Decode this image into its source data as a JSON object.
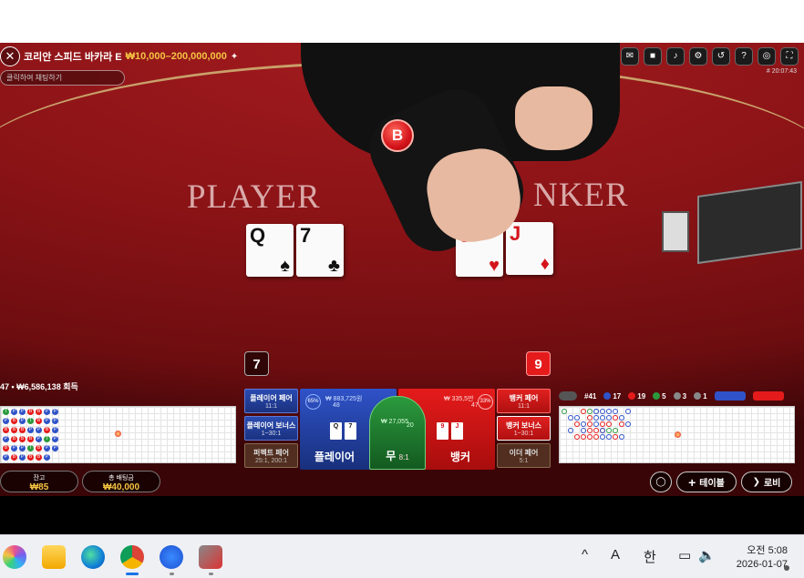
{
  "header": {
    "close_icon": "close-icon",
    "title": "코리안 스피드 바카라 E",
    "limits": "₩10,000–200,000,000",
    "chat_placeholder": "클릭하여 채팅하기",
    "game_id": "# 20:07:43"
  },
  "toolbar_icons": [
    "chat-icon",
    "video-icon",
    "sound-icon",
    "settings-icon",
    "history-icon",
    "help-icon",
    "lobby-icon",
    "fullscreen-icon"
  ],
  "table": {
    "player_word": "PLAYER",
    "banker_word": "NKER",
    "chip_label": "B",
    "player_cards": [
      {
        "rank": "Q",
        "suit": "♠",
        "color": "blk"
      },
      {
        "rank": "7",
        "suit": "♣",
        "color": "blk"
      }
    ],
    "banker_cards": [
      {
        "rank": "9",
        "suit": "♥",
        "color": "red"
      },
      {
        "rank": "J",
        "suit": "♦",
        "color": "red"
      }
    ]
  },
  "scores": {
    "player": "7",
    "banker": "9"
  },
  "total_line": "47 • ₩6,586,138 회득",
  "balance": {
    "label": "잔고",
    "value": "₩85"
  },
  "total_bet": {
    "label": "총 배팅금",
    "value": "₩40,000"
  },
  "side_bets": {
    "player_pair": {
      "label": "플레이어 페어",
      "odds": "11:1"
    },
    "player_bonus": {
      "label": "플레이어 보너스",
      "odds": "1~30:1"
    },
    "perfect_pair": {
      "label": "퍼펙트 페어",
      "odds": "25:1, 200:1"
    },
    "banker_pair": {
      "label": "뱅커 페어",
      "odds": "11:1"
    },
    "banker_bonus": {
      "label": "뱅커 보너스",
      "odds": "1~30:1"
    },
    "either_pair": {
      "label": "이더 페어",
      "odds": "5:1"
    }
  },
  "main_bets": {
    "player": {
      "label": "플레이어",
      "odds": "1:1",
      "percent": "65%",
      "amount": "₩ 883,725원",
      "count": "48",
      "cards": [
        "Q",
        "7"
      ]
    },
    "tie": {
      "label": "무",
      "odds": "8:1",
      "amount": "₩ 27,055",
      "count": "20"
    },
    "banker": {
      "label": "뱅커",
      "odds": "0.95:1",
      "percent": "33%",
      "amount": "₩ 335,5만",
      "count": "47",
      "cards": [
        "9",
        "J"
      ]
    }
  },
  "road_stats": {
    "total": "#41",
    "player": "17",
    "banker": "19",
    "tie": "5",
    "player_pair": "3",
    "banker_pair": "1"
  },
  "big_road_rows": [
    [
      "T",
      "P",
      "P",
      "B",
      "B",
      "P",
      "P"
    ],
    [
      "P",
      "B",
      "P",
      "T",
      "B",
      "P",
      "P"
    ],
    [
      "B",
      "B",
      "B",
      "P",
      "P",
      "B",
      "P"
    ],
    [
      "P",
      "B",
      "B",
      "B",
      "P",
      "T",
      "P"
    ],
    [
      "B",
      "P",
      "P",
      "T",
      "B",
      "P",
      "P"
    ],
    [
      "P",
      "B",
      "P",
      "B",
      "B",
      "P",
      ""
    ]
  ],
  "bottom_buttons": {
    "table": "테이블",
    "lobby": "로비"
  },
  "taskbar": {
    "apps": [
      "copilot-icon",
      "file-explorer-icon",
      "edge-icon",
      "chrome-icon",
      "bing-icon",
      "app-icon"
    ],
    "ime_a": "A",
    "ime_han": "한",
    "time": "오전 5:08",
    "date": "2026-01-07"
  },
  "colors": {
    "player_blue": "#2f52c8",
    "banker_red": "#e51b1b",
    "tie_green": "#2b9a3d",
    "gold": "#f4c542"
  }
}
